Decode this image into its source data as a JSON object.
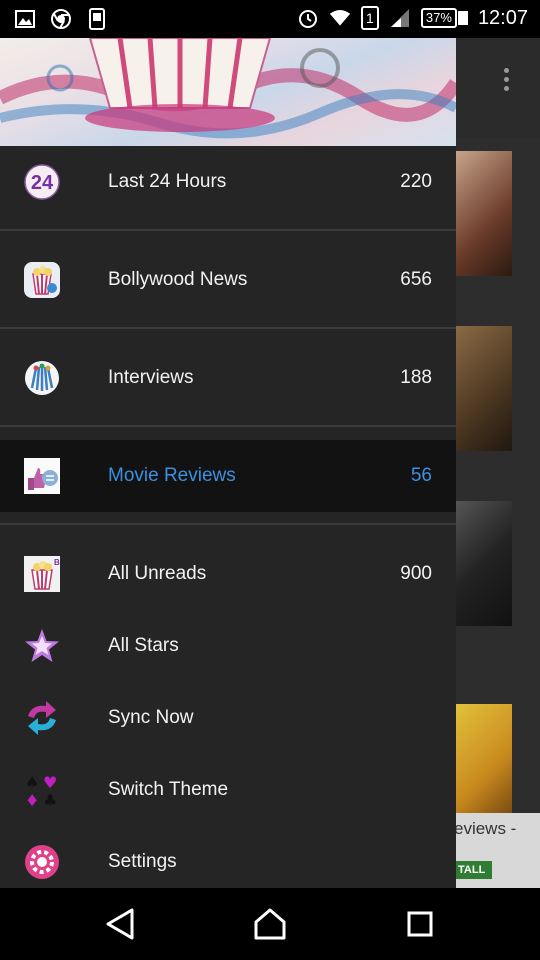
{
  "status_bar": {
    "battery": "37%",
    "time": "12:07",
    "sim_slot": "1"
  },
  "background": {
    "ad_text": "eviews -",
    "ad_button": "TALL"
  },
  "drawer": {
    "items": [
      {
        "label": "Last 24 Hours",
        "count": "220",
        "icon": "24-hours-icon"
      },
      {
        "label": "Bollywood News",
        "count": "656",
        "icon": "popcorn-icon"
      },
      {
        "label": "Interviews",
        "count": "188",
        "icon": "interview-icon"
      },
      {
        "label": "Movie Reviews",
        "count": "56",
        "icon": "thumbs-review-icon",
        "active": true
      },
      {
        "label": "All Unreads",
        "count": "900",
        "icon": "unread-icon"
      },
      {
        "label": "All Stars",
        "count": "",
        "icon": "star-icon"
      },
      {
        "label": "Sync Now",
        "count": "",
        "icon": "sync-icon"
      },
      {
        "label": "Switch Theme",
        "count": "",
        "icon": "card-suits-icon"
      },
      {
        "label": "Settings",
        "count": "",
        "icon": "gear-icon"
      }
    ]
  },
  "colors": {
    "active_text": "#3d8fe0",
    "drawer_bg": "#252525",
    "active_row_bg": "#121212"
  }
}
